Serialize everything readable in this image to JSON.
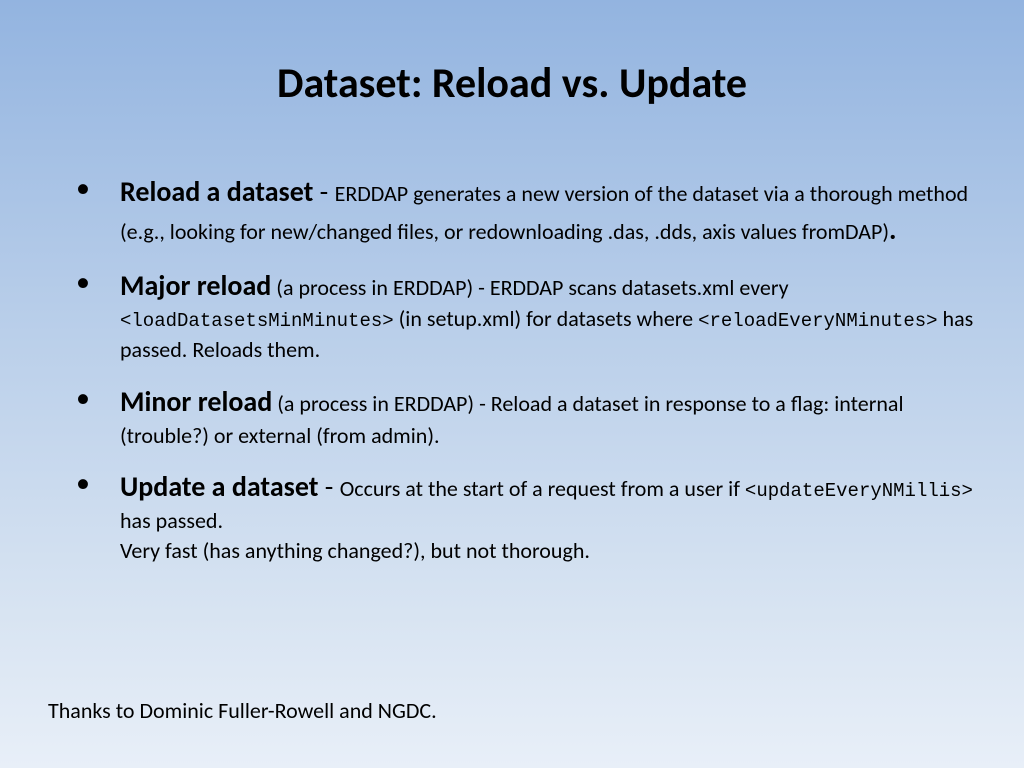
{
  "title": "Dataset: Reload vs. Update",
  "bullets": [
    {
      "lead": "Reload a dataset",
      "dash": " - ",
      "body1": "ERDDAP generates a new version of the dataset via a thorough method (e.g., looking for new/changed files, or redownloading .das, .dds, axis values fromDAP)",
      "period": "."
    },
    {
      "lead": "Major reload",
      "dash": " ",
      "body1": "(a process in ERDDAP) - ERDDAP scans datasets.xml every ",
      "mono1": "<loadDatasetsMinMinutes>",
      "body2": " (in setup.xml) for datasets where ",
      "mono2": "<reloadEveryNMinutes>",
      "body3": " has passed. Reloads them."
    },
    {
      "lead": "Minor reload",
      "dash": " ",
      "body1": "(a process in ERDDAP) - ",
      "body2": "Reload a dataset in response to a flag: internal (trouble?) or external (from admin)."
    },
    {
      "lead": "Update a dataset",
      "dash": " - ",
      "body1": "Occurs at the start of a request from a user if ",
      "mono1": "<updateEveryNMillis>",
      "body2": " has passed.",
      "br": true,
      "body3": "Very fast (has anything changed?), but not thorough."
    }
  ],
  "thanks": "Thanks to Dominic Fuller-Rowell and NGDC."
}
